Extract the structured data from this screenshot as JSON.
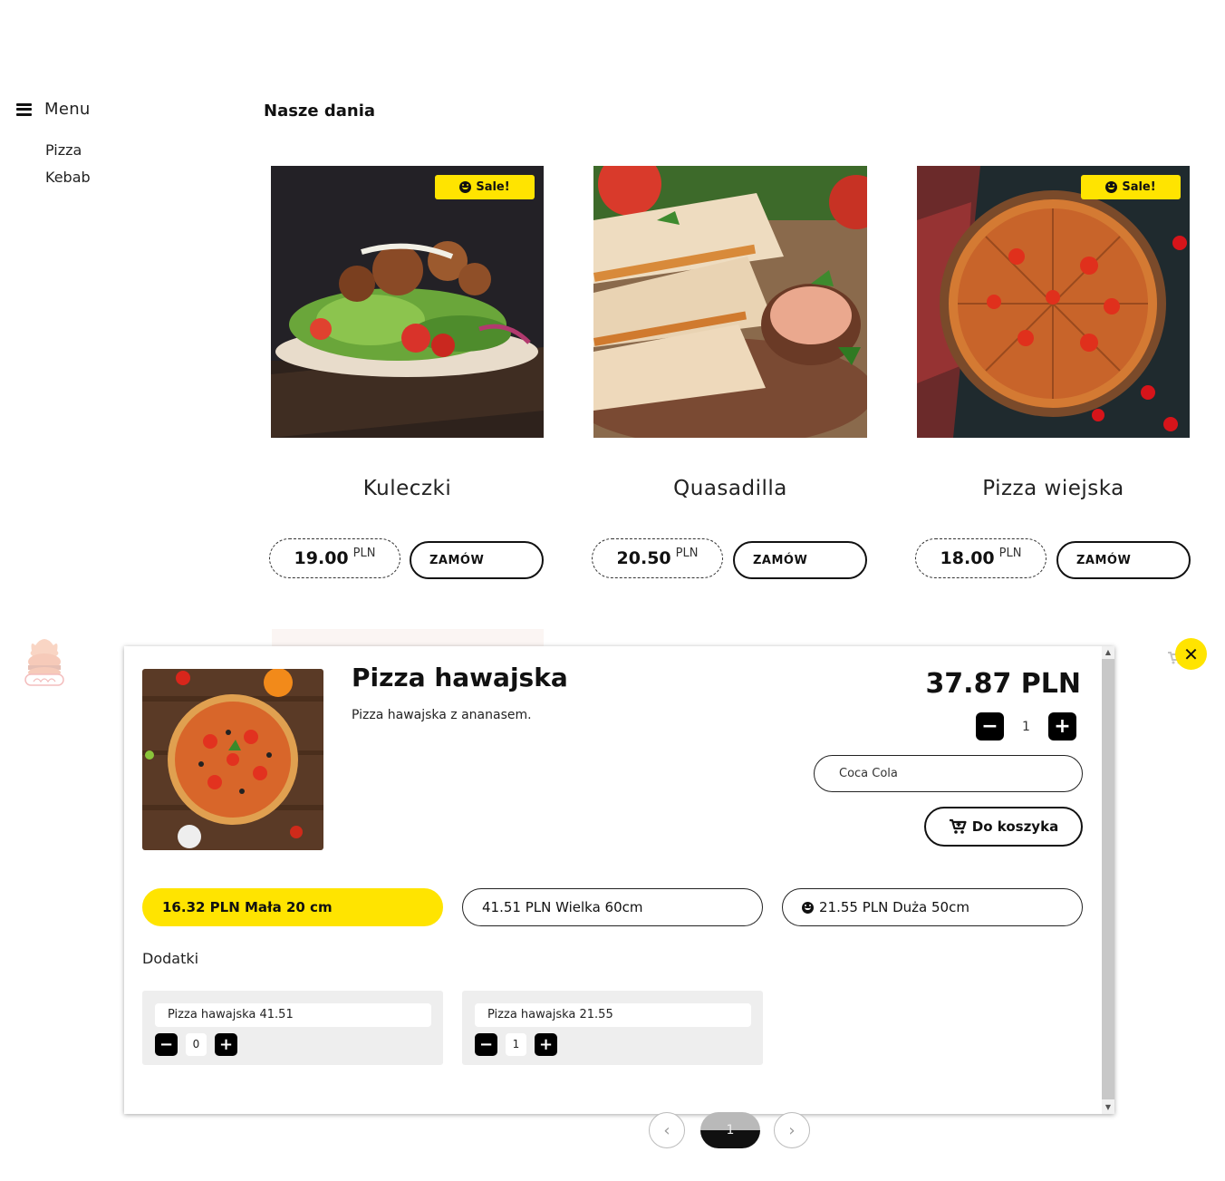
{
  "sidebar": {
    "title": "Menu",
    "categories": [
      "Pizza",
      "Kebab"
    ]
  },
  "page_title": "Nasze dania",
  "sale_label": "Sale!",
  "currency": "PLN",
  "order_label": "ZAMÓW",
  "products": [
    {
      "name": "Kuleczki",
      "price": "19.00",
      "sale": true,
      "image": "falafel-wrap-photo"
    },
    {
      "name": "Quasadilla",
      "price": "20.50",
      "sale": false,
      "image": "quesadilla-photo"
    },
    {
      "name": "Pizza wiejska",
      "price": "18.00",
      "sale": true,
      "image": "pizza-photo"
    }
  ],
  "modal": {
    "title": "Pizza hawajska",
    "description": "Pizza hawajska z ananasem.",
    "price": "37.87 PLN",
    "quantity": "1",
    "drink_value": "Coca Cola",
    "cart_label": "Do koszyka",
    "sizes": [
      {
        "label": "16.32 PLN Mała 20 cm",
        "active": true
      },
      {
        "label": "41.51 PLN Wielka 60cm",
        "active": false
      },
      {
        "label": "21.55 PLN Duża 50cm",
        "active": false,
        "icon": "smile-icon"
      }
    ],
    "addons_label": "Dodatki",
    "addons": [
      {
        "name": "Pizza hawajska 41.51",
        "qty": "0"
      },
      {
        "name": "Pizza hawajska 21.55",
        "qty": "1"
      }
    ]
  },
  "pagination": {
    "current": "1"
  },
  "colors": {
    "accent": "#ffe400",
    "text": "#111111",
    "panel": "#eeeeee"
  }
}
